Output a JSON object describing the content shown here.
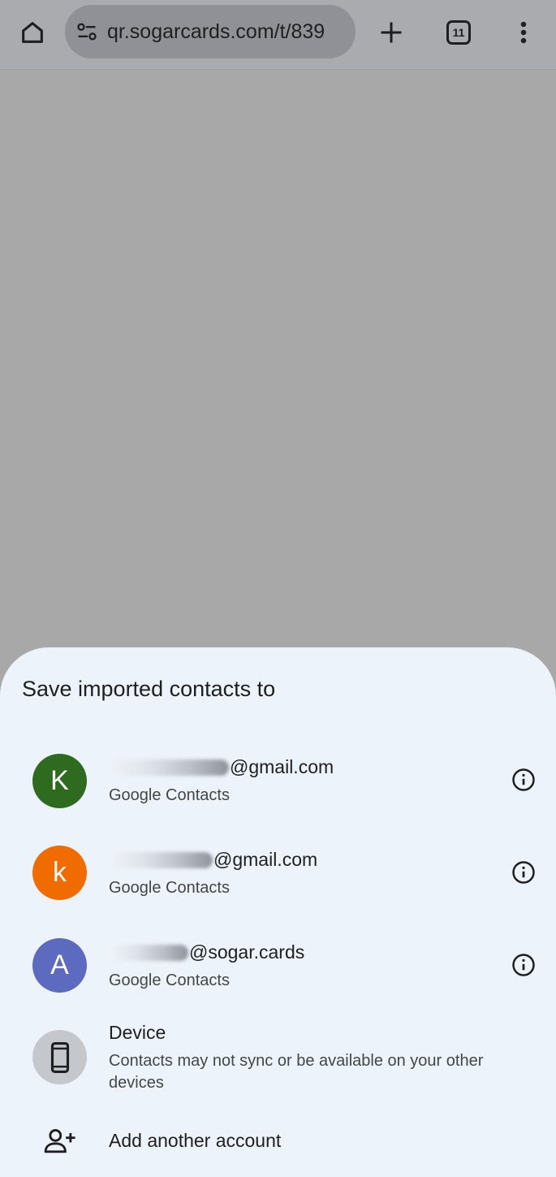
{
  "toolbar": {
    "url": "qr.sogarcards.com/t/839",
    "tab_count": "11"
  },
  "sheet": {
    "title": "Save imported contacts to",
    "accounts": [
      {
        "initial": "K",
        "color": "#2f6b1f",
        "email_suffix": "@gmail.com",
        "subtitle": "Google Contacts"
      },
      {
        "initial": "k",
        "color": "#f06c00",
        "email_suffix": "@gmail.com",
        "subtitle": "Google Contacts"
      },
      {
        "initial": "A",
        "color": "#5c6bc0",
        "email_suffix": "@sogar.cards",
        "subtitle": "Google Contacts"
      }
    ],
    "device": {
      "label": "Device",
      "description": "Contacts may not sync or be available on your other devices"
    },
    "add_account_label": "Add another account"
  }
}
